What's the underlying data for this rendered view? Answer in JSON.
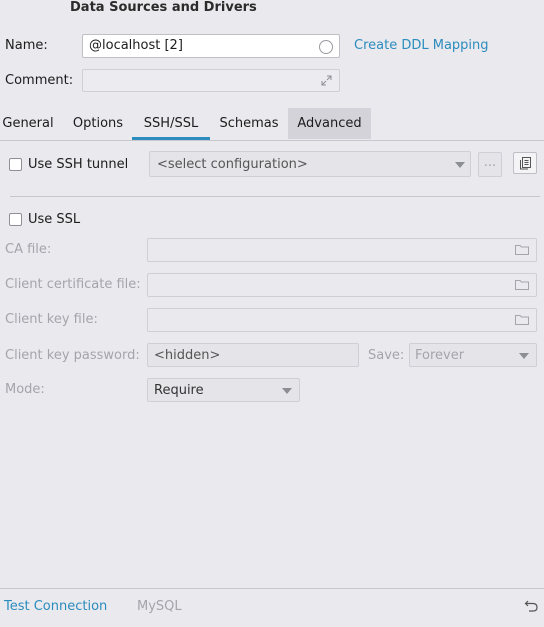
{
  "window": {
    "title": "Data Sources and Drivers"
  },
  "form": {
    "name_label": "Name:",
    "name_value": "@localhost [2]",
    "create_ddl_link": "Create DDL Mapping",
    "comment_label": "Comment:",
    "comment_value": ""
  },
  "tabs": [
    {
      "label": "General"
    },
    {
      "label": "Options"
    },
    {
      "label": "SSH/SSL",
      "active": true
    },
    {
      "label": "Schemas"
    },
    {
      "label": "Advanced",
      "hovered": true
    }
  ],
  "ssh": {
    "use_ssh_label": "Use SSH tunnel",
    "use_ssh_checked": false,
    "config_placeholder": "<select configuration>",
    "more_button": "..."
  },
  "ssl": {
    "use_ssl_label": "Use SSL",
    "use_ssl_checked": false,
    "ca_file_label": "CA file:",
    "client_cert_label": "Client certificate file:",
    "client_key_label": "Client key file:",
    "client_key_password_label": "Client key password:",
    "client_key_password_value": "<hidden>",
    "save_label": "Save:",
    "save_value": "Forever",
    "mode_label": "Mode:",
    "mode_value": "Require"
  },
  "footer": {
    "test_connection": "Test Connection",
    "driver": "MySQL"
  },
  "colors": {
    "accent": "#2c8cbd",
    "background": "#e9e9ee",
    "disabled_text": "#a4a4aa"
  },
  "icons": [
    "circle-status-icon",
    "expand-icon",
    "copy-icon",
    "folder-icon",
    "chevron-down-icon",
    "undo-icon"
  ]
}
